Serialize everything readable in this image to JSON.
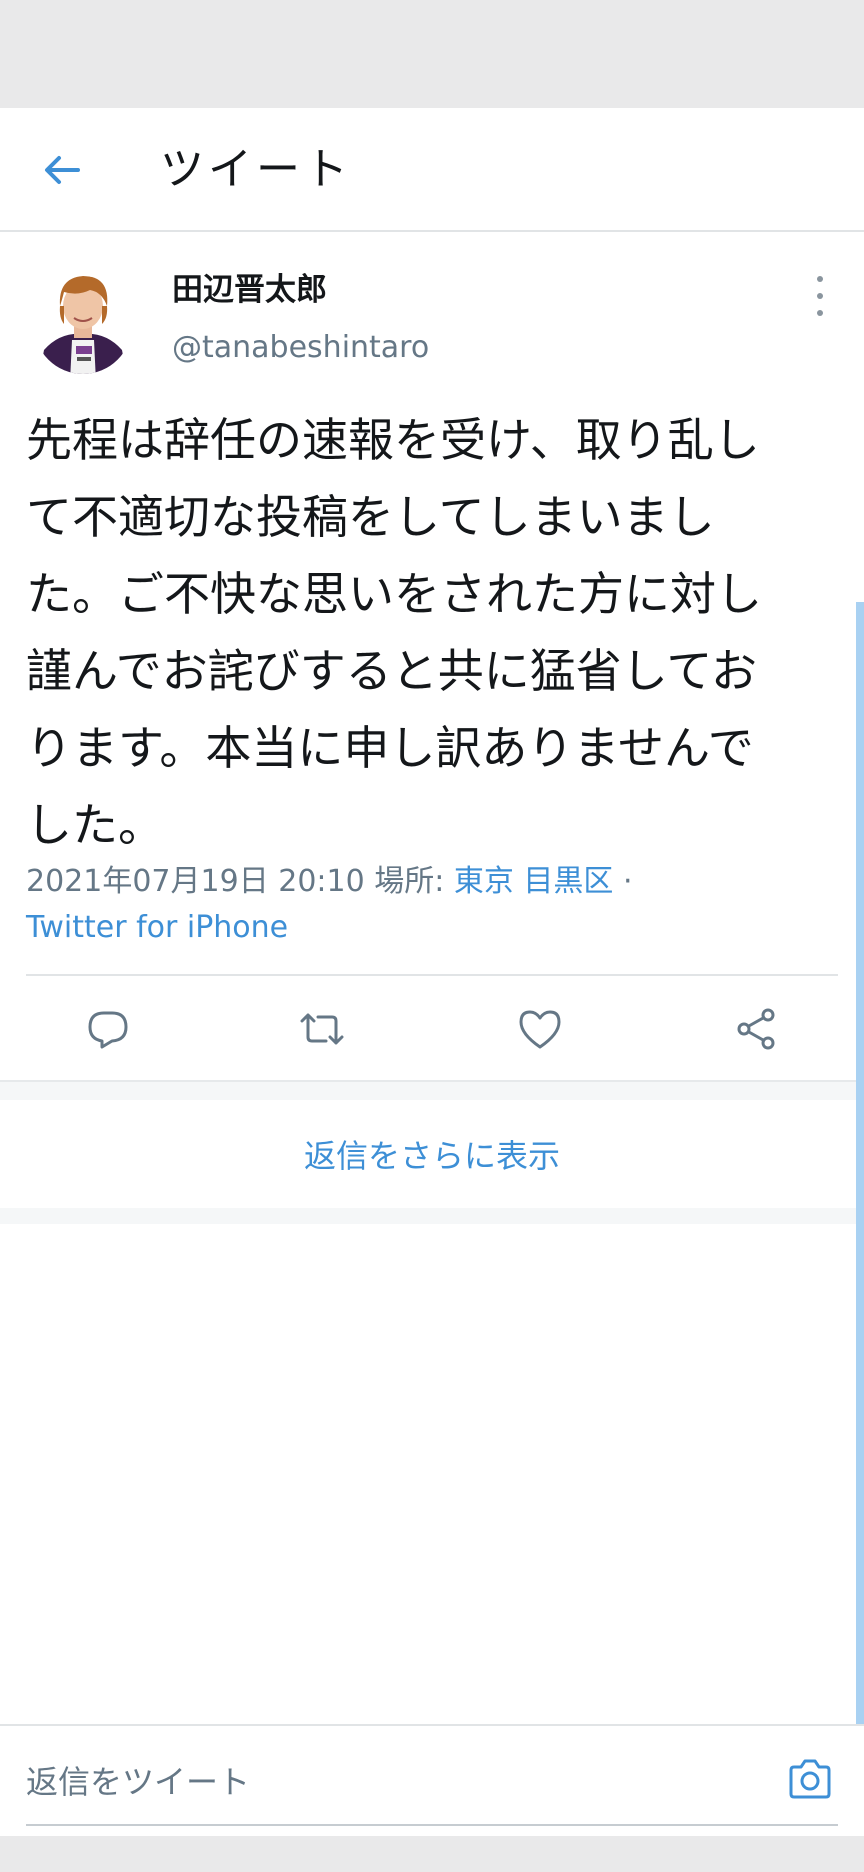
{
  "header": {
    "title": "ツイート"
  },
  "tweet": {
    "author_name": "田辺晋太郎",
    "author_handle": "@tanabeshintaro",
    "text": "先程は辞任の速報を受け、取り乱して不適切な投稿をしてしまいました。ご不快な思いをされた方に対し謹んでお詫びすると共に猛省しております。本当に申し訳ありませんでした。",
    "text_lines": [
      "先程は辞任の速報を受け、取り乱し",
      "て不適切な投稿をしてしまいまし",
      "た。ご不快な思いをされた方に対し",
      "謹んでお詫びすると共に猛省してお",
      "ります。本当に申し訳ありませんで",
      "した。"
    ],
    "timestamp": "2021年07月19日 20:10",
    "location_label": "場所:",
    "location": "東京 目黒区",
    "separator": "·",
    "source": "Twitter for iPhone"
  },
  "actions": {
    "reply_icon": "reply-icon",
    "retweet_icon": "retweet-icon",
    "like_icon": "heart-icon",
    "share_icon": "share-icon"
  },
  "more_replies": "返信をさらに表示",
  "reply_bar": {
    "placeholder": "返信をツイート",
    "camera_icon": "camera-icon"
  },
  "colors": {
    "accent": "#3d8fd6",
    "text": "#14171a",
    "secondary": "#657786",
    "divider": "#e1e4e6"
  }
}
